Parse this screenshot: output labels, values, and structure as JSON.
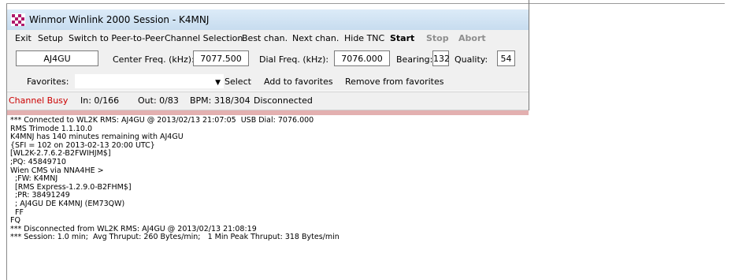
{
  "window": {
    "title": "Winmor Winlink 2000 Session - K4MNJ"
  },
  "menu": {
    "exit": "Exit",
    "setup": "Setup",
    "switch": "Switch to Peer-to-Peer",
    "channel_selection": "Channel Selection",
    "best_chan": "Best chan.",
    "next_chan": "Next chan.",
    "hide_tnc": "Hide TNC",
    "start": "Start",
    "stop": "Stop",
    "abort": "Abort"
  },
  "params": {
    "callsign": "AJ4GU",
    "center_freq_label": "Center Freq. (kHz):",
    "center_freq": "7077.500",
    "dial_freq_label": "Dial Freq. (kHz):",
    "dial_freq": "7076.000",
    "bearing_label": "Bearing:",
    "bearing": "132",
    "quality_label": "Quality:",
    "quality": "54"
  },
  "favorites": {
    "label": "Favorites:",
    "value": "",
    "select": "Select",
    "add": "Add to favorites",
    "remove": "Remove from favorites"
  },
  "status": {
    "channel": "Channel Busy",
    "channel_color": "#cc0000",
    "in": "In: 0/166",
    "out": "Out: 0/83",
    "bpm": "BPM: 318/304",
    "connection": "Disconnected"
  },
  "log": [
    "*** Connected to WL2K RMS: AJ4GU @ 2013/02/13 21:07:05  USB Dial: 7076.000",
    "RMS Trimode 1.1.10.0",
    "K4MNJ has 140 minutes remaining with AJ4GU",
    "{SFI = 102 on 2013-02-13 20:00 UTC}",
    "[WL2K-2.7.6.2-B2FWIHJM$]",
    ";PQ: 45849710",
    "Wien CMS via NNA4HE >",
    "  ;FW: K4MNJ",
    "  [RMS Express-1.2.9.0-B2FHM$]",
    "  ;PR: 38491249",
    "  ; AJ4GU DE K4MNJ (EM73QW)",
    "  FF",
    "FQ",
    "*** Disconnected from WL2K RMS: AJ4GU @ 2013/02/13 21:08:19",
    "*** Session: 1.0 min;  Avg Thruput: 260 Bytes/min;   1 Min Peak Thruput: 318 Bytes/min"
  ]
}
